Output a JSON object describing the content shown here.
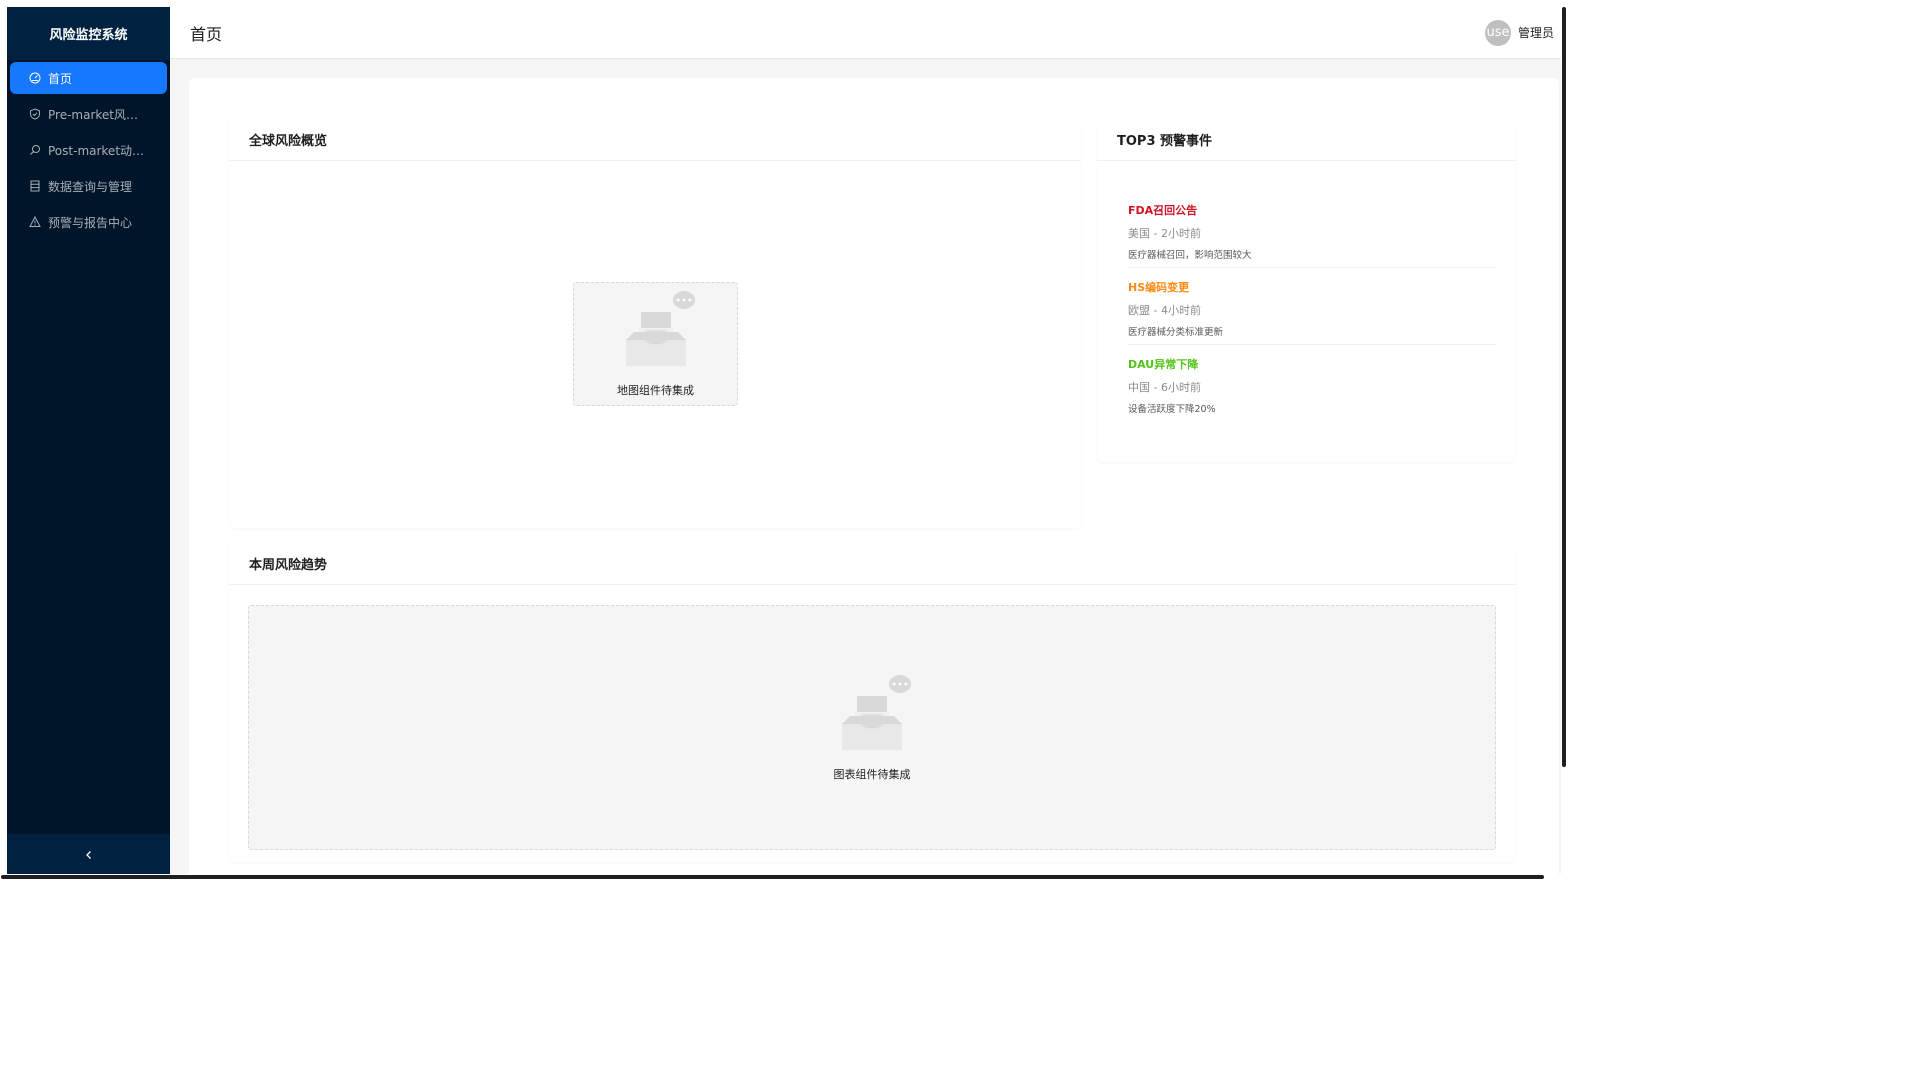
{
  "app": {
    "title": "风险监控系统"
  },
  "sidebar": {
    "items": [
      {
        "label": "首页",
        "icon": "dashboard-icon",
        "active": true
      },
      {
        "label": "Pre-market风险评估",
        "icon": "shield-icon",
        "active": false
      },
      {
        "label": "Post-market动态…",
        "icon": "search-icon",
        "active": false
      },
      {
        "label": "数据查询与管理",
        "icon": "database-icon",
        "active": false
      },
      {
        "label": "预警与报告中心",
        "icon": "warning-icon",
        "active": false
      }
    ],
    "collapse_icon": "chevron-left-icon"
  },
  "header": {
    "title": "首页",
    "user": {
      "avatar_text": "use",
      "name": "管理员"
    }
  },
  "overview": {
    "title": "全球风险概览",
    "placeholder": "地图组件待集成"
  },
  "top_alerts": {
    "title": "TOP3 预警事件",
    "items": [
      {
        "title": "FDA召回公告",
        "meta": "美国 - 2小时前",
        "desc": "医疗器械召回，影响范围较大",
        "color": "#cf1322"
      },
      {
        "title": "HS编码变更",
        "meta": "欧盟 - 4小时前",
        "desc": "医疗器械分类标准更新",
        "color": "#fa8c16"
      },
      {
        "title": "DAU异常下降",
        "meta": "中国 - 6小时前",
        "desc": "设备活跃度下降20%",
        "color": "#52c41a"
      }
    ]
  },
  "trend": {
    "title": "本周风险趋势",
    "placeholder": "图表组件待集成"
  },
  "colors": {
    "primary": "#1677ff",
    "sidebar": "#001529"
  }
}
